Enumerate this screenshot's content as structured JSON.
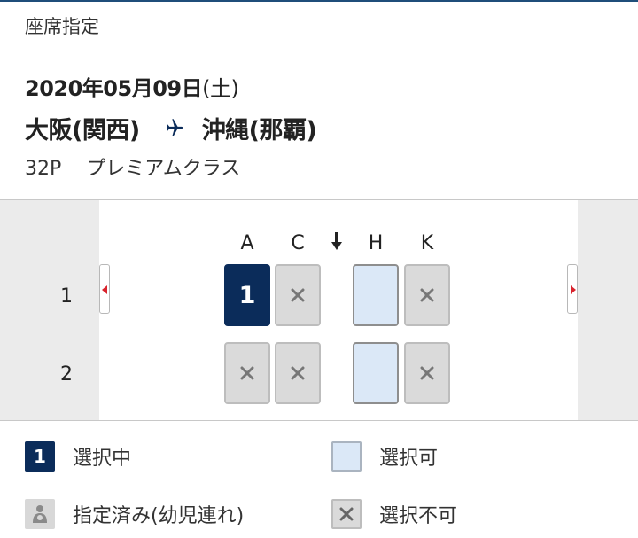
{
  "header": {
    "title": "座席指定"
  },
  "flight": {
    "date": "2020年05月09日",
    "weekday": "(土)",
    "origin": "大阪(関西)",
    "destination": "沖縄(那覇)",
    "flight_number": "32P",
    "cabin_class": "プレミアムクラス"
  },
  "seat_map": {
    "columns": [
      "A",
      "C",
      "H",
      "K"
    ],
    "rows": [
      {
        "label": "1",
        "seats": [
          {
            "col": "A",
            "status": "selected",
            "text": "1"
          },
          {
            "col": "C",
            "status": "unavailable"
          },
          {
            "col": "H",
            "status": "available"
          },
          {
            "col": "K",
            "status": "unavailable"
          }
        ]
      },
      {
        "label": "2",
        "seats": [
          {
            "col": "A",
            "status": "unavailable"
          },
          {
            "col": "C",
            "status": "unavailable"
          },
          {
            "col": "H",
            "status": "available"
          },
          {
            "col": "K",
            "status": "unavailable"
          }
        ]
      }
    ],
    "aisle_icon": "exit-arrow-down-icon"
  },
  "legend": {
    "selected_mark": "1",
    "selected": "選択中",
    "available": "選択可",
    "infant": "指定済み(幼児連れ)",
    "unavailable": "選択不可"
  },
  "colors": {
    "selected": "#0b2c5a",
    "available": "#dbe8f7",
    "unavailable": "#dadada",
    "accent_red": "#d9232d"
  }
}
